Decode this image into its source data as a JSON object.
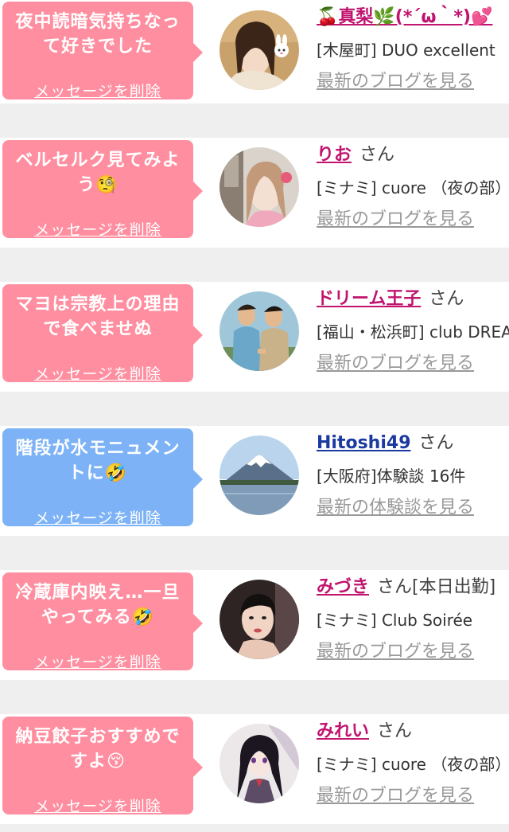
{
  "posts": [
    {
      "message": "夜中読暗気持ちなって好きでした",
      "delete_label": "メッセージを削除",
      "name": "🍒真梨🌿(*´ω｀*)💕",
      "honorific": "",
      "shop": "[木屋町] DUO excellent",
      "link": "最新のブログを見る",
      "avatar_icon": "girl-bunny-avatar"
    },
    {
      "message": "ベルセルク見てみよう🧐",
      "delete_label": "メッセージを削除",
      "name": "りお",
      "honorific": "さん",
      "shop": "[ミナミ] cuore （夜の部）",
      "link": "最新のブログを見る",
      "avatar_icon": "girl-window-avatar"
    },
    {
      "message": "マヨは宗教上の理由で食べませぬ",
      "delete_label": "メッセージを削除",
      "name": "ドリーム王子",
      "honorific": "さん",
      "shop": "[福山・松浜町]  club DREAM",
      "link": "最新のブログを見る",
      "avatar_icon": "anime-men-avatar"
    },
    {
      "message": "階段が水モニュメントに🤣",
      "delete_label": "メッセージを削除",
      "name": "Hitoshi49",
      "honorific": "さん",
      "shop": "[大阪府]体験談 16件",
      "link": "最新の体験談を見る",
      "avatar_icon": "mount-fuji-avatar"
    },
    {
      "message": "冷蔵庫内映え…一旦やってみる🤣",
      "delete_label": "メッセージを削除",
      "name": "みづき",
      "honorific": "さん[本日出勤]",
      "shop": "[ミナミ] Club Soirée",
      "link": "最新のブログを見る",
      "avatar_icon": "woman-portrait-avatar"
    },
    {
      "message": "納豆餃子おすすめですよ😚",
      "delete_label": "メッセージを削除",
      "name": "みれい",
      "honorific": "さん",
      "shop": "[ミナミ] cuore （夜の部）",
      "link": "最新のブログを見る",
      "avatar_icon": "anime-girl-avatar"
    }
  ],
  "colors": {
    "bubble_pink": "#ff8fa0",
    "bubble_blue": "#7db3f6",
    "name_magenta": "#c0146f",
    "name_navy": "#1b3aa0",
    "link_gray": "#999999",
    "separator": "#efefef"
  }
}
